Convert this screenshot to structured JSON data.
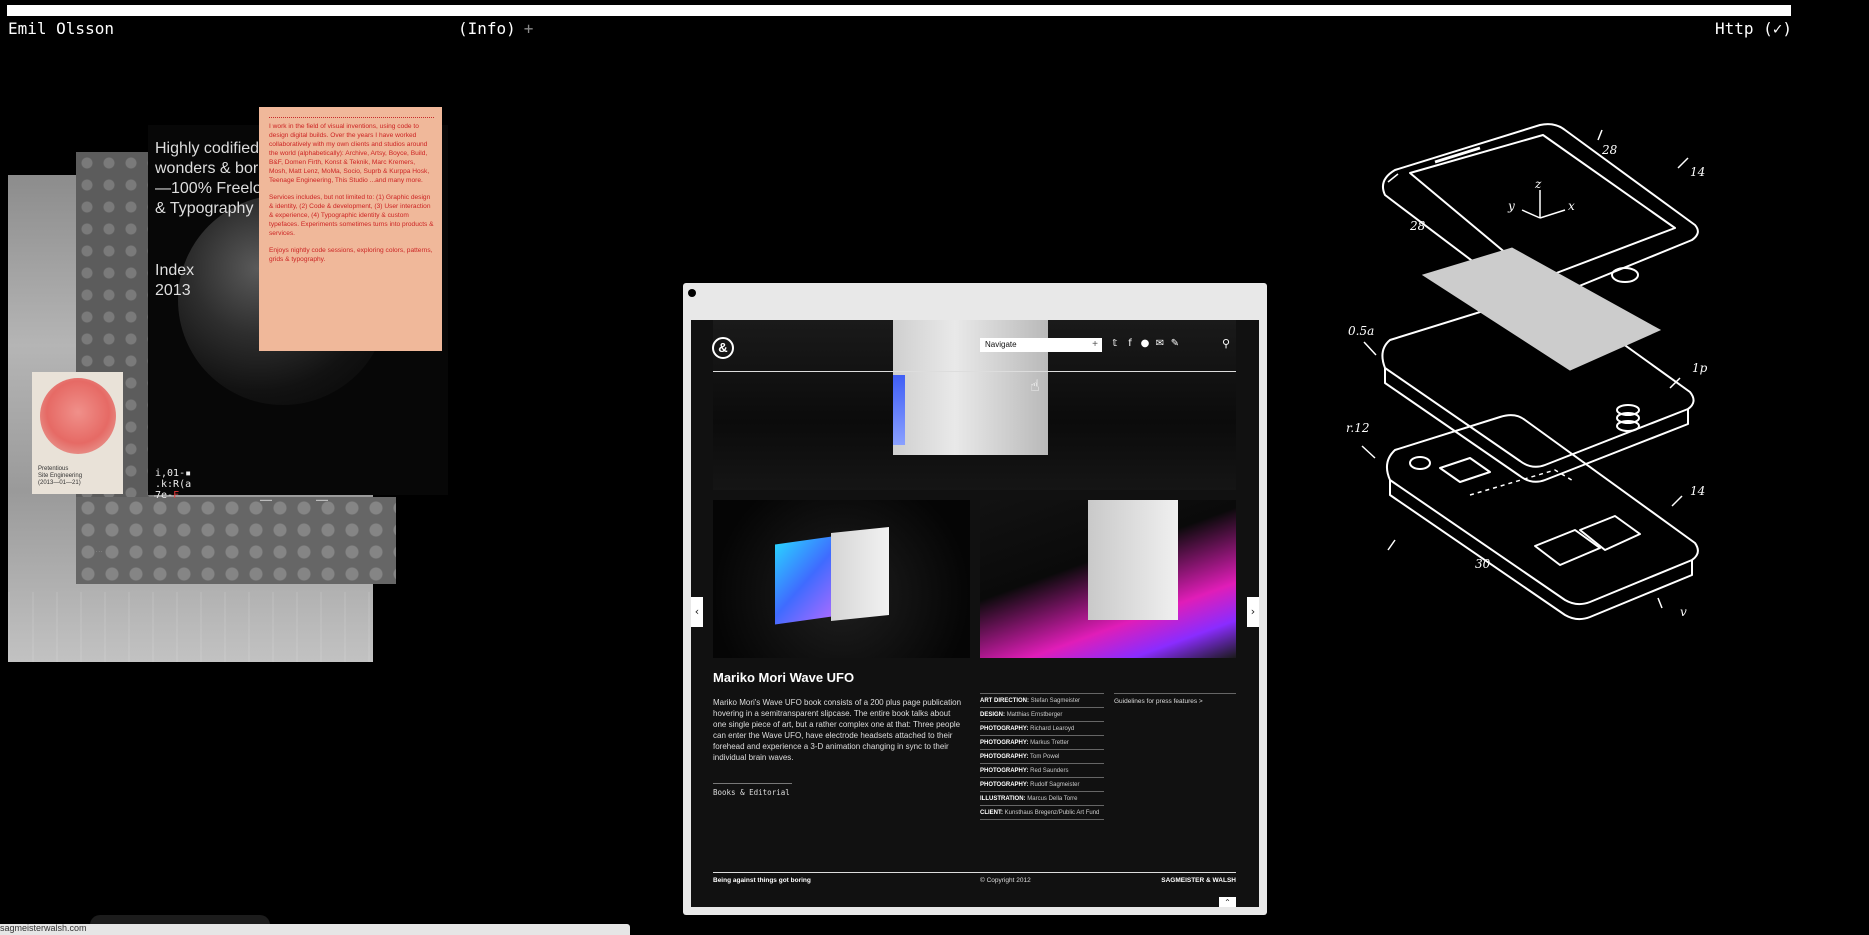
{
  "header": {
    "site_name": "Emil Olsson",
    "info_label": "(Info)",
    "info_plus": "+",
    "http_label": "Http (✓)"
  },
  "collage": {
    "headline": "Highly codified\nwonders & bor\n—100% Freelo\n& Typography",
    "index_label": "Index",
    "index_year": "2013",
    "glyph_lines": [
      "i,01-▪",
      ".k:R(a",
      "7e-"
    ],
    "glyph_red": "F",
    "poster_text": "Pretentious\nSite Engineering\n(2013—01—21)",
    "bio": "I work in the field of visual inventions, using code to design digital builds. Over the years I have worked collaboratively with my own clients and studios around the world (alphabetically): Archive, Artsy, Boyce, Build, B&F, Domen Firth, Konst & Teknik, Marc Kremers, Mosh, Matt Lenz, MoMa, Socio, Suprb & Kurppa Hosk, Teenage Engineering, This Studio ...and many more.",
    "services": "Services includes, but not limited to: (1) Graphic design & identity, (2) Code & development, (3) User interaction & experience, (4) Typographic identity & custom typefaces. Experiments sometimes turns into products & services.",
    "enjoys": "Enjoys nightly code sessions, exploring colors, patterns, grids & typography."
  },
  "browser": {
    "nav_placeholder": "Navigate",
    "nav_plus": "+",
    "logo": "&",
    "project": {
      "title": "Mariko Mori Wave UFO",
      "description": "Mariko Mori's Wave UFO book consists of a 200 plus page publication hovering in a semitransparent slipcase. The entire book talks about one single piece of art, but a rather complex one at that: Three people can enter the Wave UFO, have electrode headsets attached to their forehead and experience a 3-D animation changing in sync to their individual brain waves.",
      "category": "Books & Editorial",
      "credits": [
        {
          "role": "ART DIRECTION:",
          "name": "Stefan Sagmeister"
        },
        {
          "role": "DESIGN:",
          "name": "Matthias Ernstberger"
        },
        {
          "role": "PHOTOGRAPHY:",
          "name": "Richard Learoyd"
        },
        {
          "role": "PHOTOGRAPHY:",
          "name": "Markus Tretter"
        },
        {
          "role": "PHOTOGRAPHY:",
          "name": "Tom Powel"
        },
        {
          "role": "PHOTOGRAPHY:",
          "name": "Red Saunders"
        },
        {
          "role": "PHOTOGRAPHY:",
          "name": "Rudolf Sagmeister"
        },
        {
          "role": "ILLUSTRATION:",
          "name": "Marcus Della Torre"
        },
        {
          "role": "CLIENT:",
          "name": "Kunsthaus Bregenz/Public Art Fund"
        }
      ],
      "press_link": "Guidelines for press features >"
    },
    "footer": {
      "tagline": "Being against things got boring",
      "copyright": "© Copyright 2012",
      "brand": "SAGMEISTER & WALSH"
    }
  },
  "patent_labels": {
    "l28a": "28",
    "l14a": "14",
    "l28b": "28",
    "lz": "z",
    "ly": "y",
    "lx": "x",
    "l05a": "0.5a",
    "l1p": "1p",
    "lr12": "r.12",
    "l14b": "14",
    "l30": "30",
    "lv": "v"
  },
  "status": {
    "url": "sagmeisterwalsh.com"
  }
}
